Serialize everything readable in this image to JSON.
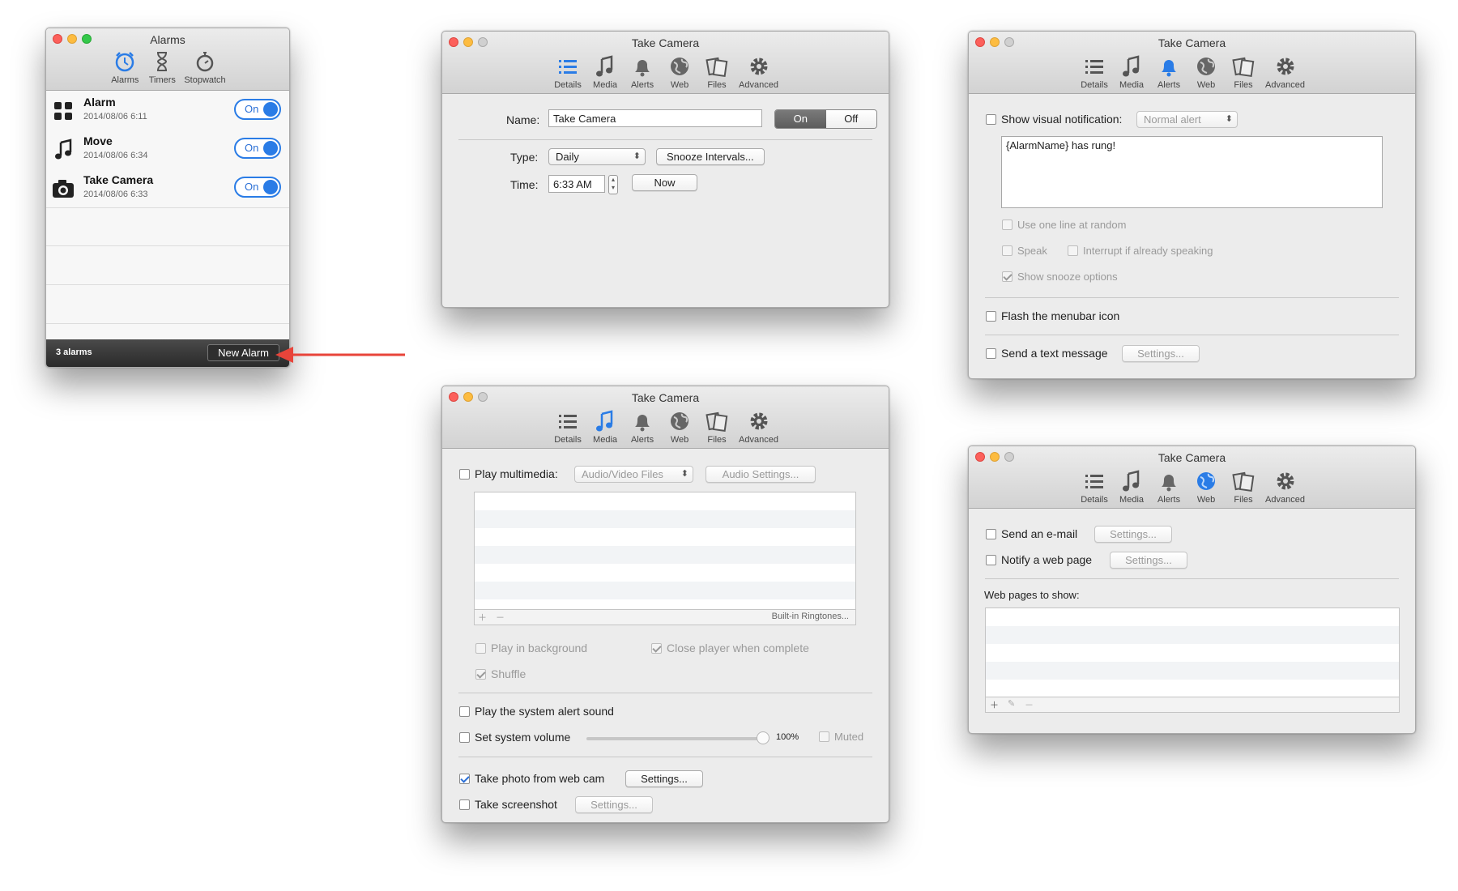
{
  "alarms_window": {
    "title": "Alarms",
    "toolbar": [
      {
        "label": "Alarms",
        "icon": "alarm-clock-icon",
        "active": true
      },
      {
        "label": "Timers",
        "icon": "hourglass-icon",
        "active": false
      },
      {
        "label": "Stopwatch",
        "icon": "stopwatch-icon",
        "active": false
      }
    ],
    "items": [
      {
        "name": "Alarm",
        "date": "2014/08/06 6:11",
        "state": "On",
        "icon": "grid-icon"
      },
      {
        "name": "Move",
        "date": "2014/08/06 6:34",
        "state": "On",
        "icon": "music-note-icon"
      },
      {
        "name": "Take Camera",
        "date": "2014/08/06 6:33",
        "state": "On",
        "icon": "camera-icon"
      }
    ],
    "footer_count": "3 alarms",
    "new_alarm_label": "New Alarm",
    "arrow_color": "#e8443a"
  },
  "editor_tabs": [
    {
      "label": "Details",
      "icon": "list-icon"
    },
    {
      "label": "Media",
      "icon": "music-note-icon"
    },
    {
      "label": "Alerts",
      "icon": "bell-icon"
    },
    {
      "label": "Web",
      "icon": "globe-icon"
    },
    {
      "label": "Files",
      "icon": "files-icon"
    },
    {
      "label": "Advanced",
      "icon": "gear-icon"
    }
  ],
  "details_window": {
    "title": "Take Camera",
    "active_tab": "Details",
    "name_label": "Name:",
    "name_value": "Take Camera",
    "on_label": "On",
    "off_label": "Off",
    "type_label": "Type:",
    "type_value": "Daily",
    "snooze_button": "Snooze Intervals...",
    "time_label": "Time:",
    "time_value": "6:33 AM",
    "now_button": "Now"
  },
  "media_window": {
    "title": "Take Camera",
    "active_tab": "Media",
    "play_multimedia": "Play multimedia:",
    "media_source": "Audio/Video Files",
    "audio_settings": "Audio Settings...",
    "ringtones": "Built-in Ringtones...",
    "play_background": "Play in background",
    "close_player": "Close player when complete",
    "shuffle": "Shuffle",
    "system_alert": "Play the system alert sound",
    "system_volume": "Set system volume",
    "volume_value": "100%",
    "muted": "Muted",
    "take_photo": "Take photo from web cam",
    "take_photo_settings": "Settings...",
    "take_screenshot": "Take screenshot",
    "screenshot_settings": "Settings..."
  },
  "alerts_window": {
    "title": "Take Camera",
    "active_tab": "Alerts",
    "show_visual": "Show visual notification:",
    "alert_type": "Normal alert",
    "message_text": "{AlarmName} has rung!",
    "one_line": "Use one line at random",
    "speak": "Speak",
    "interrupt": "Interrupt if already speaking",
    "snooze_options": "Show snooze options",
    "flash_menubar": "Flash the menubar icon",
    "send_text": "Send a text message",
    "text_settings": "Settings..."
  },
  "web_window": {
    "title": "Take Camera",
    "active_tab": "Web",
    "send_email": "Send an e-mail",
    "email_settings": "Settings...",
    "notify_web": "Notify a web page",
    "notify_settings": "Settings...",
    "pages_label": "Web pages to show:"
  }
}
